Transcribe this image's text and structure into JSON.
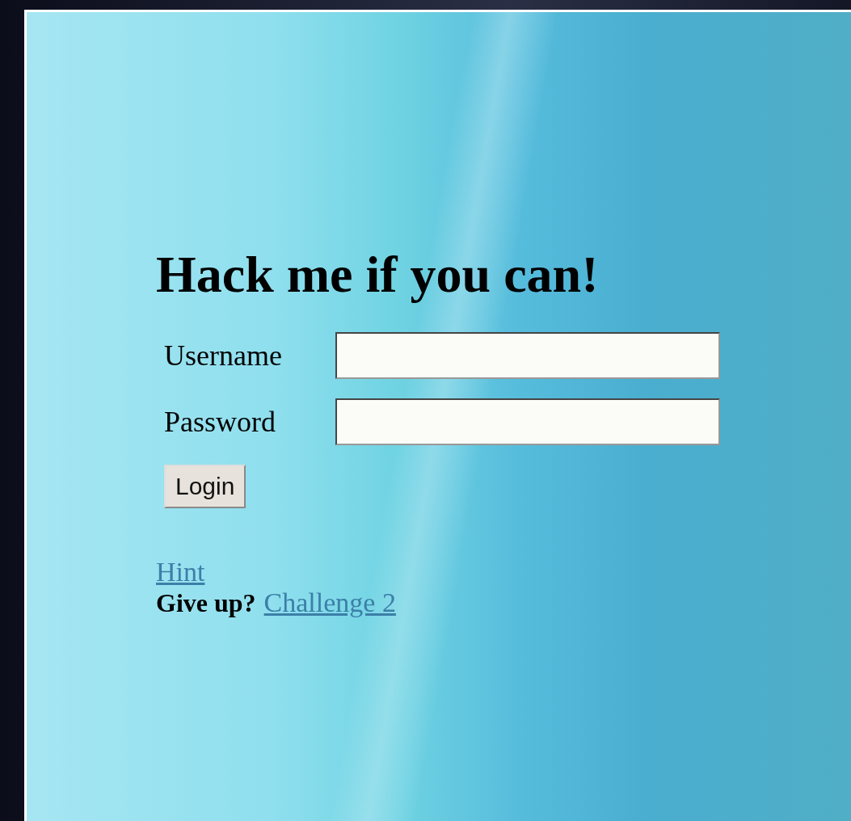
{
  "heading": "Hack me if you can!",
  "fields": [
    {
      "label": "Username"
    },
    {
      "label": "Password"
    }
  ],
  "login_button": "Login",
  "hint_link": "Hint",
  "give_up": {
    "text": "Give up?",
    "link": "Challenge 2"
  }
}
